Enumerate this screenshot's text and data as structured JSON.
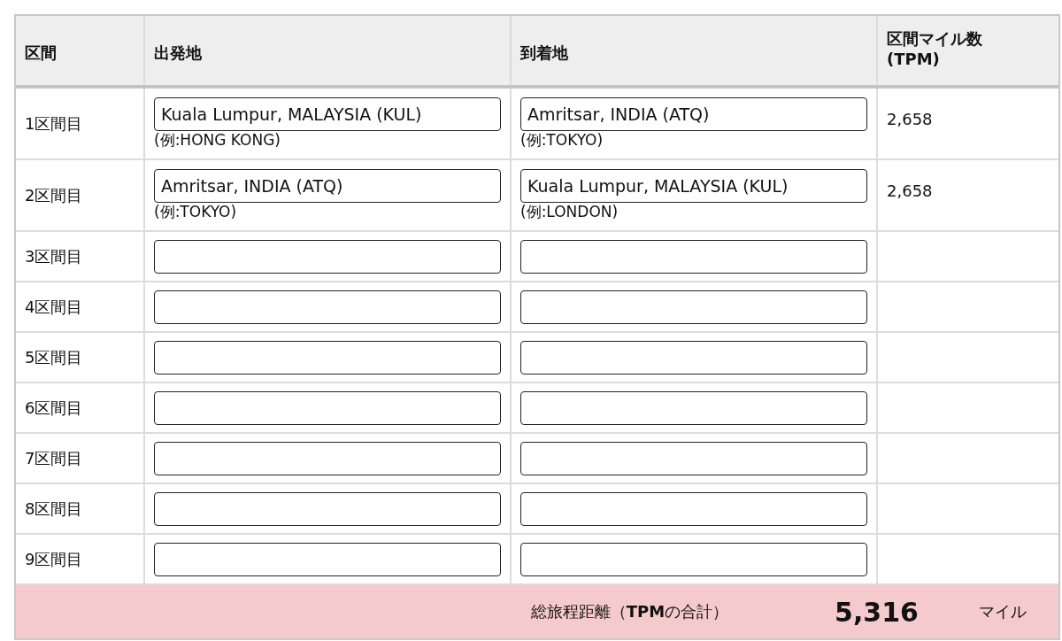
{
  "table": {
    "columns": [
      {
        "label": "区間"
      },
      {
        "label": "出発地"
      },
      {
        "label": "到着地"
      },
      {
        "label": "区間マイル数",
        "sub": "(TPM)"
      }
    ],
    "rows": [
      {
        "segment": "1区間目",
        "origin": {
          "value": "Kuala Lumpur, MALAYSIA (KUL)",
          "example": "(例:HONG KONG)"
        },
        "destination": {
          "value": "Amritsar, INDIA (ATQ)",
          "example": "(例:TOKYO)"
        },
        "tpm": "2,658"
      },
      {
        "segment": "2区間目",
        "origin": {
          "value": "Amritsar, INDIA (ATQ)",
          "example": "(例:TOKYO)"
        },
        "destination": {
          "value": "Kuala Lumpur, MALAYSIA (KUL)",
          "example": "(例:LONDON)"
        },
        "tpm": "2,658"
      },
      {
        "segment": "3区間目",
        "origin": {},
        "destination": {}
      },
      {
        "segment": "4区間目",
        "origin": {},
        "destination": {}
      },
      {
        "segment": "5区間目",
        "origin": {},
        "destination": {}
      },
      {
        "segment": "6区間目",
        "origin": {},
        "destination": {}
      },
      {
        "segment": "7区間目",
        "origin": {},
        "destination": {}
      },
      {
        "segment": "8区間目",
        "origin": {},
        "destination": {}
      },
      {
        "segment": "9区間目",
        "origin": {},
        "destination": {}
      }
    ],
    "total": {
      "label": "総旅程距離（**TPM**の合計）",
      "value": "5,316",
      "unit": "マイル"
    }
  }
}
